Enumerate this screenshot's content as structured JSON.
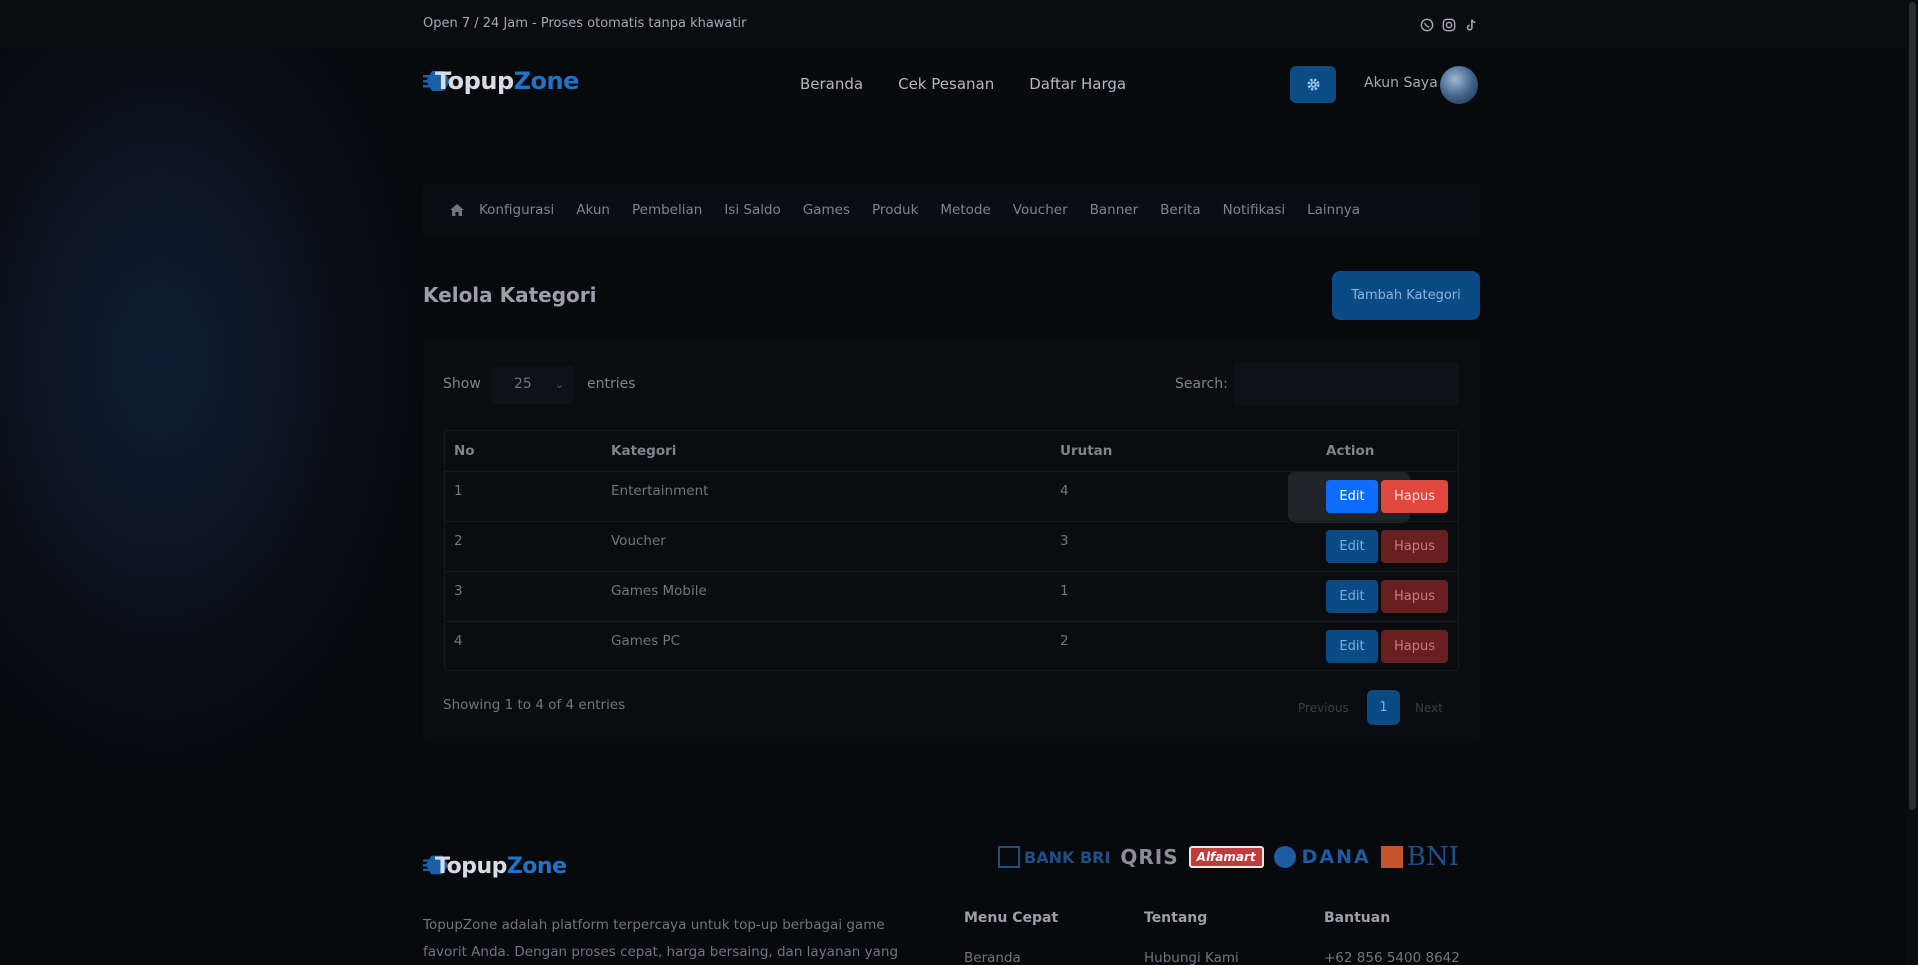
{
  "topbar": {
    "tagline": "Open 7 / 24 Jam - Proses otomatis tanpa khawatir",
    "socials": [
      "whatsapp-icon",
      "instagram-icon",
      "tiktok-icon"
    ]
  },
  "brand": {
    "part1": "Topup",
    "part2": "Zone",
    "accent": "#1e74c8"
  },
  "nav": {
    "items": [
      "Beranda",
      "Cek Pesanan",
      "Daftar Harga"
    ]
  },
  "account": {
    "label": "Akun Saya"
  },
  "admin_menu": {
    "items": [
      "Konfigurasi",
      "Akun",
      "Pembelian",
      "Isi Saldo",
      "Games",
      "Produk",
      "Metode",
      "Voucher",
      "Banner",
      "Berita",
      "Notifikasi",
      "Lainnya"
    ]
  },
  "page": {
    "title": "Kelola Kategori",
    "add_button": "Tambah Kategori"
  },
  "table_controls": {
    "show_label": "Show",
    "entries_value": "25",
    "entries_label": "entries",
    "search_label": "Search:",
    "search_value": ""
  },
  "table": {
    "columns": [
      "No",
      "Kategori",
      "Urutan",
      "Action"
    ],
    "rows": [
      {
        "no": "1",
        "kategori": "Entertainment",
        "urutan": "4"
      },
      {
        "no": "2",
        "kategori": "Voucher",
        "urutan": "3"
      },
      {
        "no": "3",
        "kategori": "Games Mobile",
        "urutan": "1"
      },
      {
        "no": "4",
        "kategori": "Games PC",
        "urutan": "2"
      }
    ],
    "edit_label": "Edit",
    "delete_label": "Hapus"
  },
  "pagination": {
    "info": "Showing 1 to 4 of 4 entries",
    "previous": "Previous",
    "current": "1",
    "next": "Next"
  },
  "footer": {
    "payment_logos": [
      "BANK BRI",
      "QRIS",
      "Alfamart",
      "DANA",
      "BNI"
    ],
    "description": "TopupZone adalah platform terpercaya untuk top-up berbagai game favorit Anda. Dengan proses cepat, harga bersaing, dan layanan yang mudah digunakan,",
    "columns": [
      {
        "title": "Menu Cepat",
        "first_item": "Beranda"
      },
      {
        "title": "Tentang",
        "first_item": "Hubungi Kami"
      },
      {
        "title": "Bantuan",
        "first_item": "+62 856 5400 8642"
      }
    ]
  },
  "colors": {
    "primary": "#0d6efd",
    "danger": "#dc3545",
    "background": "#07090d"
  }
}
